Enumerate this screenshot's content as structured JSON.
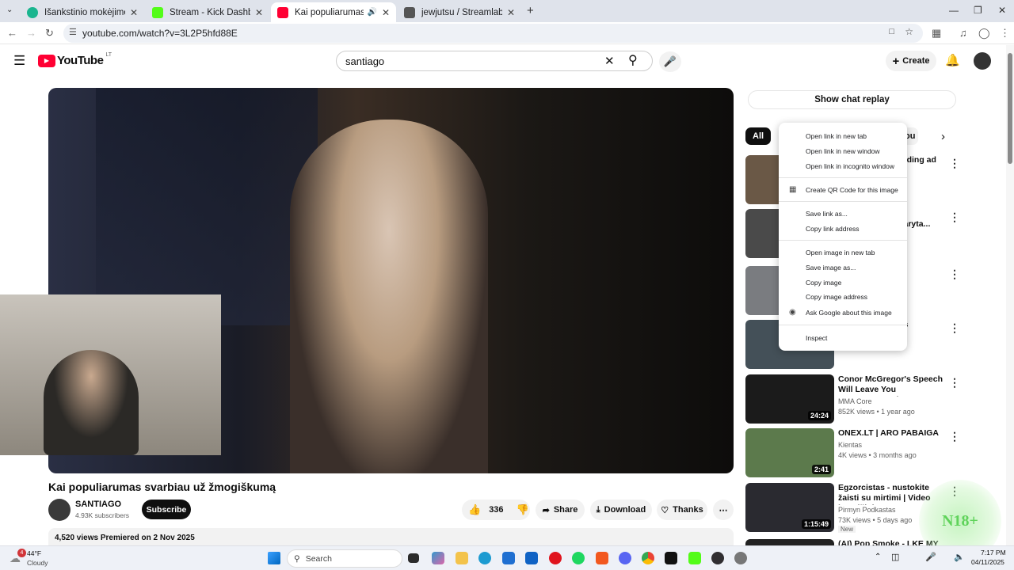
{
  "browser": {
    "tabs": [
      {
        "title": "Išankstinio mokėjimo telefono",
        "fav": "#1ab58f"
      },
      {
        "title": "Stream - Kick Dashboard",
        "fav": "#53fc18"
      },
      {
        "title": "Kai populiarumas svarbiau",
        "fav": "#ff0033"
      },
      {
        "title": "jewjutsu / Streamlabs",
        "fav": "#555555"
      }
    ],
    "url": "youtube.com/watch?v=3L2P5hfd88E"
  },
  "youtube": {
    "logo": "YouTube",
    "region": "LT",
    "search_value": "santiago",
    "create_label": "Create",
    "video_title": "Kai populiarumas svarbiau už žmogiškumą",
    "channel_name": "SANTIAGO",
    "subscribers": "4.93K subscribers",
    "subscribe_label": "Subscribe",
    "likes": "336",
    "share_label": "Share",
    "download_label": "Download",
    "thanks_label": "Thanks",
    "desc_meta": "4,520 views  Premiered on 2 Nov 2025",
    "chat_replay_label": "Show chat replay",
    "chip_all": "All",
    "chip_partial": "ou"
  },
  "recommendations": [
    {
      "title": "re holding ad",
      "channel": "",
      "meta": "ago",
      "duration": "",
      "thumb": "#6a5846"
    },
    {
      "title": "iekas epadaryta...",
      "channel": "",
      "meta": "",
      "duration": "",
      "thumb": "#4a4a4a"
    },
    {
      "title": "",
      "channel": "",
      "meta": "",
      "duration": "",
      "thumb": "#7a7c80"
    },
    {
      "title": "lkatos",
      "channel": "",
      "meta": "ago",
      "duration": "",
      "thumb": "#445058"
    },
    {
      "title": "Conor McGregor's Speech Will Leave You SPEECHLESS | One ...",
      "channel": "MMA Core",
      "meta": "852K views • 1 year ago",
      "duration": "24:24",
      "thumb": "#1b1b1b"
    },
    {
      "title": "ONEX.LT |  ARO PABAIGA",
      "channel": "Kientas",
      "meta": "4K views • 3 months ago",
      "duration": "2:41",
      "thumb": "#5c7a4c"
    },
    {
      "title": "Egzorcistas - nustokite žaisti su mirtimi |  Video kopylčioje, ...",
      "channel": "Pirmyn Podkastas",
      "meta": "73K views • 5 days ago",
      "duration": "1:15:49",
      "thumb": "#2a2a30",
      "badge": "New"
    },
    {
      "title": "(AI) Pop Smoke - LKE MY VIBE / ...",
      "channel": "",
      "meta": "",
      "duration": "",
      "thumb": "#222222"
    }
  ],
  "context_menu": {
    "open_new_tab": "Open link in new tab",
    "open_new_window": "Open link in new window",
    "open_incognito": "Open link in incognito window",
    "create_qr": "Create QR Code for this image",
    "save_link": "Save link as...",
    "copy_link": "Copy link address",
    "open_image": "Open image in new tab",
    "save_image": "Save image as...",
    "copy_image": "Copy image",
    "copy_image_address": "Copy image address",
    "ask_google": "Ask Google about this image",
    "inspect": "Inspect"
  },
  "overlay": {
    "badge_text": "N18+"
  },
  "taskbar": {
    "temperature": "44°F",
    "weather": "Cloudy",
    "weather_badge": "4",
    "search_placeholder": "Search",
    "time": "7:17 PM",
    "date": "04/11/2025"
  }
}
